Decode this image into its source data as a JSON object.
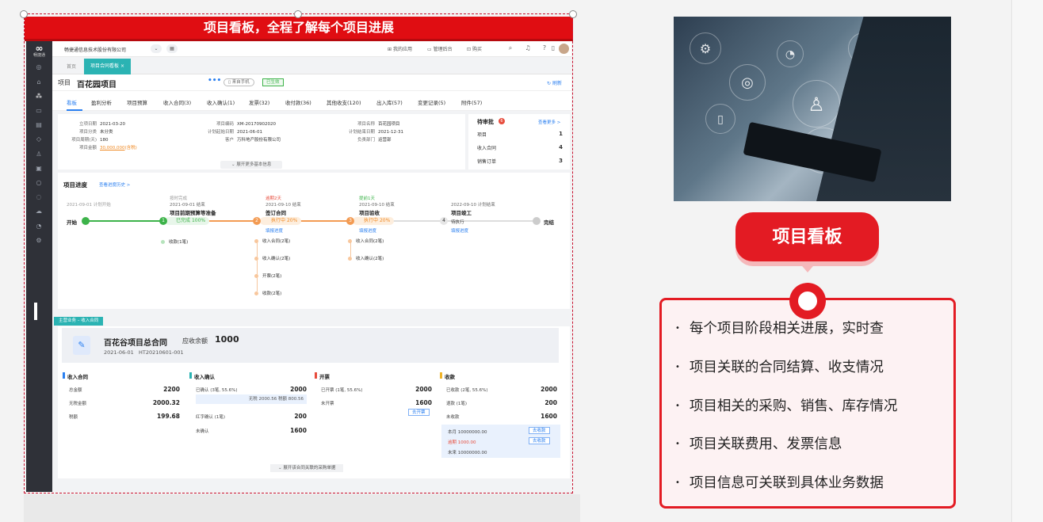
{
  "banner": {
    "title": "项目看板，全程了解每个项目进展"
  },
  "sidebar": {
    "logo_text": "畅捷通"
  },
  "topbar": {
    "company": "畅捷通信息技术股份有限公司",
    "apps": "我的应用",
    "admin": "管理后台",
    "purchase": "购买"
  },
  "tabs": {
    "home": "首页",
    "active": "项目合同看板"
  },
  "project": {
    "label": "项目",
    "name": "百花园项目",
    "more": "•••",
    "source": "来自手机",
    "status": "已生效",
    "refresh": "刷新"
  },
  "subtabs": [
    "看板",
    "盈利分析",
    "项目预算",
    "收入合同(3)",
    "收入确认(1)",
    "发票(32)",
    "收付款(36)",
    "其他收支(120)",
    "出入库(57)",
    "变更记录(5)",
    "附件(57)"
  ],
  "info": {
    "start_date_k": "立项日期",
    "start_date_v": "2021-03-20",
    "category_k": "项目分类",
    "category_v": "未分类",
    "cycle_k": "项目周期(天)",
    "cycle_v": "180",
    "amount_k": "项目金额",
    "amount_v": "30,000,000",
    "amount_note": "(含税)",
    "code_k": "项目编码",
    "code_v": "XM-20170902020",
    "plan_start_k": "计划起始日期",
    "plan_start_v": "2021-06-01",
    "customer_k": "客户",
    "customer_v": "万科地产股份有限公司",
    "pname_k": "项目名称",
    "pname_v": "百花园项目",
    "plan_end_k": "计划结束日期",
    "plan_end_v": "2021-12-31",
    "dept_k": "负责部门",
    "dept_v": "运营部",
    "expand": "展开更多基本信息"
  },
  "pending": {
    "title": "待审批",
    "count": "6",
    "more": "查看更多 >",
    "rows": [
      {
        "label": "项目",
        "value": "1"
      },
      {
        "label": "收入合同",
        "value": "4"
      },
      {
        "label": "销售订单",
        "value": "3"
      }
    ]
  },
  "progress": {
    "title": "项目进度",
    "history": "查看进度历史 >",
    "start": "开始",
    "end": "完结",
    "start_plan": "2021-09-01 计划开始",
    "stages": [
      {
        "num": "1",
        "note": "按时完成",
        "date": "2021-09-01 结束",
        "name": "项目前期预算等准备",
        "state": "已完成",
        "pct": "100%",
        "fill_pct": 100,
        "link": "",
        "subs": [
          "收款(1笔)"
        ]
      },
      {
        "num": "2",
        "note": "逾期2天",
        "date": "2021-09-10 结束",
        "name": "签订合同",
        "state": "执行中",
        "pct": "20%",
        "fill_pct": 20,
        "link": "填报进度",
        "subs": [
          "收入合同(2笔)",
          "收入确认(2笔)",
          "开票(2笔)",
          "收款(2笔)"
        ]
      },
      {
        "num": "3",
        "note": "提前1天",
        "date": "2021-09-10 结束",
        "name": "项目验收",
        "state": "执行中",
        "pct": "20%",
        "fill_pct": 20,
        "link": "填报进度",
        "subs": [
          "收入合同(2笔)",
          "收入确认(2笔)"
        ]
      },
      {
        "num": "4",
        "note": "",
        "date": "2022-09-10 计划结束",
        "name": "项目竣工",
        "state": "待执行",
        "pct": "",
        "fill_pct": 0,
        "link": "填报进度",
        "subs": []
      }
    ]
  },
  "section_tag": "主营业务 – 收入合同",
  "contract": {
    "name": "百花谷项目总合同",
    "due_label": "应收余额",
    "due_value": "1000",
    "date": "2021-06-01",
    "code": "HT20210601-001",
    "expand": "展开该合同关联的采购单据"
  },
  "columns": {
    "income": {
      "title": "收入合同",
      "rows": [
        [
          "总金额",
          "2200"
        ],
        [
          "无税金额",
          "2000.32"
        ],
        [
          "税额",
          "199.68"
        ]
      ]
    },
    "confirm": {
      "title": "收入确认",
      "confirmed": "已确认 (3笔, 55.6%)",
      "confirmed_v": "2000",
      "detail": "无税 2000.56 税额 800.56",
      "red": "红字确认 (1笔)",
      "red_v": "200",
      "unconfirmed": "未确认",
      "unconfirmed_v": "1600"
    },
    "invoice": {
      "title": "开票",
      "issued": "已开票 (1笔, 55.6%)",
      "issued_v": "2000",
      "unissued": "未开票",
      "unissued_v": "1600",
      "btn": "去开票"
    },
    "receipt": {
      "title": "收款",
      "received": "已收款 (2笔, 55.6%)",
      "received_v": "2000",
      "refund": "退款 (1笔)",
      "refund_v": "200",
      "unreceived": "未收款",
      "unreceived_v": "1600",
      "month": "本月 10000000.00",
      "overdue": "逾期 1000.00",
      "future": "未来 10000000.00",
      "btn1": "去收款",
      "btn2": "去收款"
    }
  },
  "right": {
    "pill": "项目看板",
    "bullets": [
      "每个项目阶段相关进展，实时查",
      "项目关联的合同结算、收支情况",
      "项目相关的采购、销售、库存情况",
      "项目关联费用、发票信息",
      "项目信息可关联到具体业务数据"
    ]
  },
  "colors": {
    "brand_red": "#e31b23",
    "banner_red": "#e00d12",
    "teal": "#2bb3b3",
    "link_blue": "#2a7ff0",
    "done_green": "#3db34a",
    "progress_orange": "#f39b53"
  }
}
